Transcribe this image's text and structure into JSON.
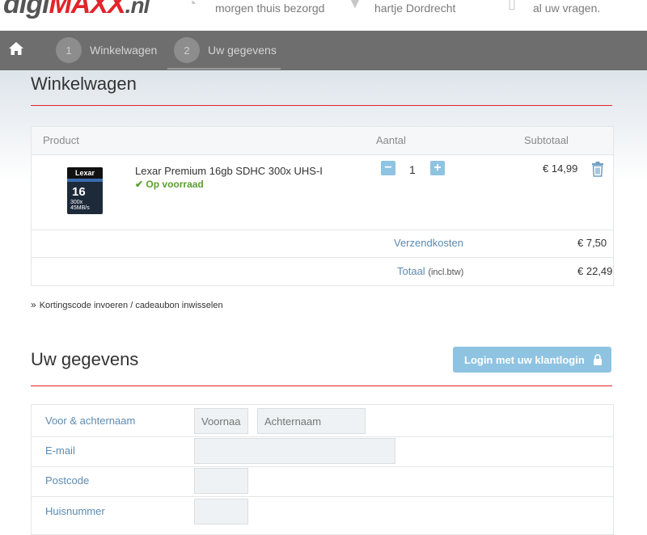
{
  "brand": {
    "part1": "digi",
    "part2": "MAXX",
    "part3": ".nl"
  },
  "usps": [
    "morgen thuis bezorgd",
    "hartje Dordrecht",
    "al uw vragen."
  ],
  "nav": {
    "steps": [
      {
        "number": "1",
        "label": "Winkelwagen"
      },
      {
        "number": "2",
        "label": "Uw gegevens"
      }
    ]
  },
  "cart": {
    "title": "Winkelwagen",
    "headers": {
      "product": "Product",
      "quantity": "Aantal",
      "subtotal": "Subtotaal"
    },
    "item": {
      "name": "Lexar Premium 16gb SDHC 300x UHS-I",
      "stock": "Op voorraad",
      "quantity": "1",
      "subtotal": "€ 14,99",
      "image": {
        "brand": "Lexar",
        "capacity": "16",
        "speed": "300x 45MB/s"
      }
    },
    "shipping_label": "Verzendkosten",
    "shipping_value": "€ 7,50",
    "total_label": "Totaal",
    "total_note": "(incl.btw)",
    "total_value": "€ 22,49"
  },
  "coupon_link": "Kortingscode invoeren / cadeaubon inwisselen",
  "details": {
    "title": "Uw gegevens",
    "login_button": "Login met uw klantlogin",
    "fields": {
      "name_label": "Voor & achternaam",
      "firstname_placeholder": "Voornaam",
      "lastname_placeholder": "Achternaam",
      "email_label": "E-mail",
      "postcode_label": "Postcode",
      "housenumber_label": "Huisnummer"
    }
  },
  "colors": {
    "accent": "#e2242b",
    "link": "#5b8bb1",
    "button": "#8fc3e2",
    "stock": "#5aa02c"
  }
}
